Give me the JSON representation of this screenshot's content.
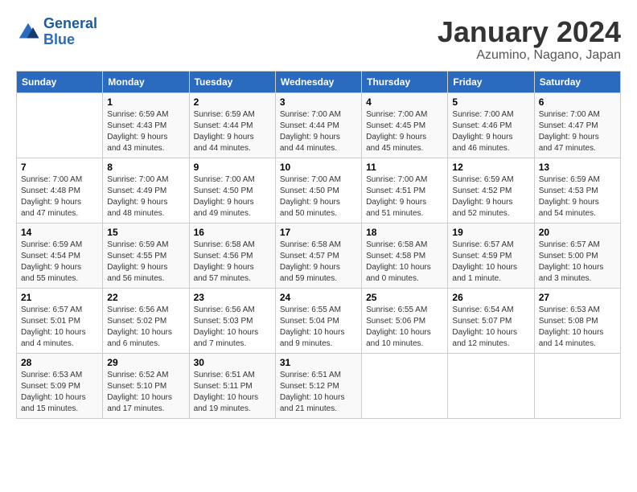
{
  "logo": {
    "line1": "General",
    "line2": "Blue"
  },
  "title": "January 2024",
  "location": "Azumino, Nagano, Japan",
  "weekdays": [
    "Sunday",
    "Monday",
    "Tuesday",
    "Wednesday",
    "Thursday",
    "Friday",
    "Saturday"
  ],
  "weeks": [
    [
      {
        "day": "",
        "info": ""
      },
      {
        "day": "1",
        "info": "Sunrise: 6:59 AM\nSunset: 4:43 PM\nDaylight: 9 hours\nand 43 minutes."
      },
      {
        "day": "2",
        "info": "Sunrise: 6:59 AM\nSunset: 4:44 PM\nDaylight: 9 hours\nand 44 minutes."
      },
      {
        "day": "3",
        "info": "Sunrise: 7:00 AM\nSunset: 4:44 PM\nDaylight: 9 hours\nand 44 minutes."
      },
      {
        "day": "4",
        "info": "Sunrise: 7:00 AM\nSunset: 4:45 PM\nDaylight: 9 hours\nand 45 minutes."
      },
      {
        "day": "5",
        "info": "Sunrise: 7:00 AM\nSunset: 4:46 PM\nDaylight: 9 hours\nand 46 minutes."
      },
      {
        "day": "6",
        "info": "Sunrise: 7:00 AM\nSunset: 4:47 PM\nDaylight: 9 hours\nand 47 minutes."
      }
    ],
    [
      {
        "day": "7",
        "info": "Sunrise: 7:00 AM\nSunset: 4:48 PM\nDaylight: 9 hours\nand 47 minutes."
      },
      {
        "day": "8",
        "info": "Sunrise: 7:00 AM\nSunset: 4:49 PM\nDaylight: 9 hours\nand 48 minutes."
      },
      {
        "day": "9",
        "info": "Sunrise: 7:00 AM\nSunset: 4:50 PM\nDaylight: 9 hours\nand 49 minutes."
      },
      {
        "day": "10",
        "info": "Sunrise: 7:00 AM\nSunset: 4:50 PM\nDaylight: 9 hours\nand 50 minutes."
      },
      {
        "day": "11",
        "info": "Sunrise: 7:00 AM\nSunset: 4:51 PM\nDaylight: 9 hours\nand 51 minutes."
      },
      {
        "day": "12",
        "info": "Sunrise: 6:59 AM\nSunset: 4:52 PM\nDaylight: 9 hours\nand 52 minutes."
      },
      {
        "day": "13",
        "info": "Sunrise: 6:59 AM\nSunset: 4:53 PM\nDaylight: 9 hours\nand 54 minutes."
      }
    ],
    [
      {
        "day": "14",
        "info": "Sunrise: 6:59 AM\nSunset: 4:54 PM\nDaylight: 9 hours\nand 55 minutes."
      },
      {
        "day": "15",
        "info": "Sunrise: 6:59 AM\nSunset: 4:55 PM\nDaylight: 9 hours\nand 56 minutes."
      },
      {
        "day": "16",
        "info": "Sunrise: 6:58 AM\nSunset: 4:56 PM\nDaylight: 9 hours\nand 57 minutes."
      },
      {
        "day": "17",
        "info": "Sunrise: 6:58 AM\nSunset: 4:57 PM\nDaylight: 9 hours\nand 59 minutes."
      },
      {
        "day": "18",
        "info": "Sunrise: 6:58 AM\nSunset: 4:58 PM\nDaylight: 10 hours\nand 0 minutes."
      },
      {
        "day": "19",
        "info": "Sunrise: 6:57 AM\nSunset: 4:59 PM\nDaylight: 10 hours\nand 1 minute."
      },
      {
        "day": "20",
        "info": "Sunrise: 6:57 AM\nSunset: 5:00 PM\nDaylight: 10 hours\nand 3 minutes."
      }
    ],
    [
      {
        "day": "21",
        "info": "Sunrise: 6:57 AM\nSunset: 5:01 PM\nDaylight: 10 hours\nand 4 minutes."
      },
      {
        "day": "22",
        "info": "Sunrise: 6:56 AM\nSunset: 5:02 PM\nDaylight: 10 hours\nand 6 minutes."
      },
      {
        "day": "23",
        "info": "Sunrise: 6:56 AM\nSunset: 5:03 PM\nDaylight: 10 hours\nand 7 minutes."
      },
      {
        "day": "24",
        "info": "Sunrise: 6:55 AM\nSunset: 5:04 PM\nDaylight: 10 hours\nand 9 minutes."
      },
      {
        "day": "25",
        "info": "Sunrise: 6:55 AM\nSunset: 5:06 PM\nDaylight: 10 hours\nand 10 minutes."
      },
      {
        "day": "26",
        "info": "Sunrise: 6:54 AM\nSunset: 5:07 PM\nDaylight: 10 hours\nand 12 minutes."
      },
      {
        "day": "27",
        "info": "Sunrise: 6:53 AM\nSunset: 5:08 PM\nDaylight: 10 hours\nand 14 minutes."
      }
    ],
    [
      {
        "day": "28",
        "info": "Sunrise: 6:53 AM\nSunset: 5:09 PM\nDaylight: 10 hours\nand 15 minutes."
      },
      {
        "day": "29",
        "info": "Sunrise: 6:52 AM\nSunset: 5:10 PM\nDaylight: 10 hours\nand 17 minutes."
      },
      {
        "day": "30",
        "info": "Sunrise: 6:51 AM\nSunset: 5:11 PM\nDaylight: 10 hours\nand 19 minutes."
      },
      {
        "day": "31",
        "info": "Sunrise: 6:51 AM\nSunset: 5:12 PM\nDaylight: 10 hours\nand 21 minutes."
      },
      {
        "day": "",
        "info": ""
      },
      {
        "day": "",
        "info": ""
      },
      {
        "day": "",
        "info": ""
      }
    ]
  ]
}
